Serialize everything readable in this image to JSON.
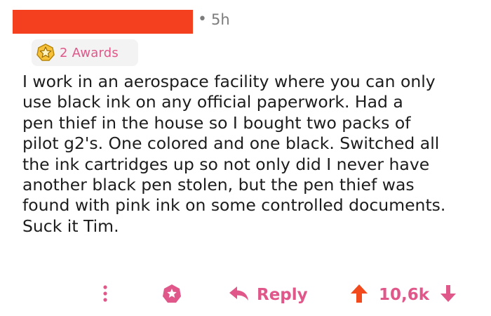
{
  "comment": {
    "time_ago": "5h",
    "awards_label": "2 Awards",
    "body": "I work in an aerospace facility where you can only\nuse black ink on any official paperwork. Had a\npen thief in the house so I bought two packs of\npilot g2's. One colored and one black. Switched all\nthe ink cartridges up so not only did I never have\nanother black pen stolen, but the pen thief was\nfound with pink ink on some controlled documents.\nSuck it Tim."
  },
  "actions": {
    "reply_label": "Reply",
    "score": "10,6k"
  },
  "icons": {
    "award": "award-badge-icon",
    "more": "more-options-icon",
    "give_award": "give-award-icon",
    "reply": "reply-arrow-icon",
    "upvote": "upvote-arrow-icon",
    "downvote": "downvote-arrow-icon"
  },
  "colors": {
    "redaction": "#f5401f",
    "accent_pink": "#e0578a",
    "upvote_red": "#f24a1d",
    "muted_text": "#7c7c7c",
    "chip_bg": "#f3f3f3"
  }
}
